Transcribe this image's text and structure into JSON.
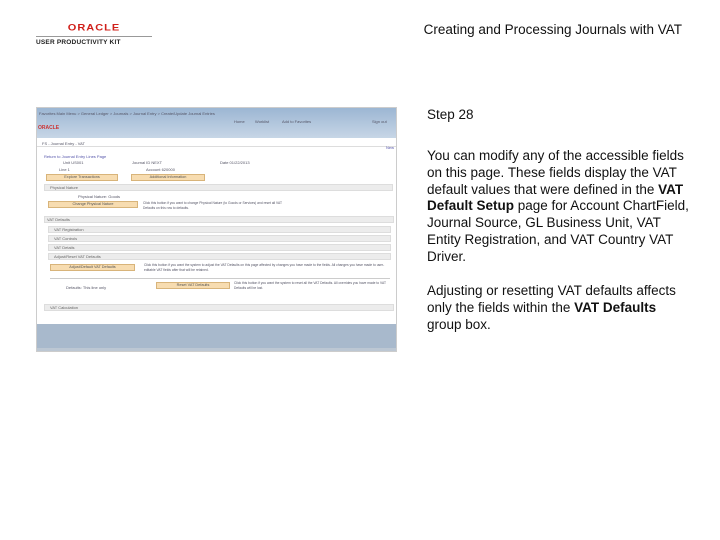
{
  "logo": {
    "brand": "ORACLE",
    "sub": "USER PRODUCTIVITY KIT"
  },
  "doc_title": "Creating and Processing Journals with VAT",
  "screenshot": {
    "nav_top": "Favorites   Main Menu  >  General Ledger  >  Journals  >  Journal Entry  >  Create/Update Journal Entries",
    "nav_links": [
      "Home",
      "Worklist",
      "Add to Favorites",
      "Sign out"
    ],
    "brand": "ORACLE",
    "breadcrumb": "FS - Journal Entry - VAT",
    "new_link": "New",
    "return_link": "Return to Journal Entry Lines Page",
    "fields": [
      "Unit  US001",
      "Journal ID  NEXT",
      "Date  01/22/2013",
      "Line  1",
      "Account  620000"
    ],
    "buttons_top": [
      "Explore Transactions",
      "Additional Information"
    ],
    "physical_nature_bar": "Physical Nature",
    "physical_nature_value": "Physical Nature:  Goods",
    "change_pn_button": "Change Physical Nature",
    "change_pn_help": "Click this button if you want to change Physical Nature (to Goods or Services) and reset all VAT Defaults on this row to defaults.",
    "vat_defaults_header": "VAT Defaults",
    "sections": [
      "VAT Registration",
      "VAT Controls",
      "VAT Details",
      "Adjust/Reset VAT Defaults"
    ],
    "adjust_button": "Adjust/Default VAT Defaults",
    "adjust_help": "Click this button if you want the system to adjust the VAT Defaults on this page affected by changes you have made to the fields. All changes you have made to user-editable VAT fields after that will be retained.",
    "defaults_scope": "Defaults: This line only",
    "reset_button": "Reset VAT Defaults",
    "reset_help": "Click this button if you want the system to reset all the VAT Defaults. All overrides you have made to VAT Defaults will be lost.",
    "vat_calc_bar": "VAT Calculation"
  },
  "step": "Step 28",
  "para1": [
    {
      "t": "You can modify any of the accessible fields on this page. These fields display the VAT default values that were defined in the "
    },
    {
      "b": "VAT Default Setup"
    },
    {
      "t": " page for Account ChartField, Journal Source, GL Business Unit, VAT Entity Registration, and VAT Country VAT Driver."
    }
  ],
  "para2": [
    {
      "t": "Adjusting or resetting VAT defaults affects only the fields within the "
    },
    {
      "b": "VAT Defaults"
    },
    {
      "t": " group box."
    }
  ]
}
